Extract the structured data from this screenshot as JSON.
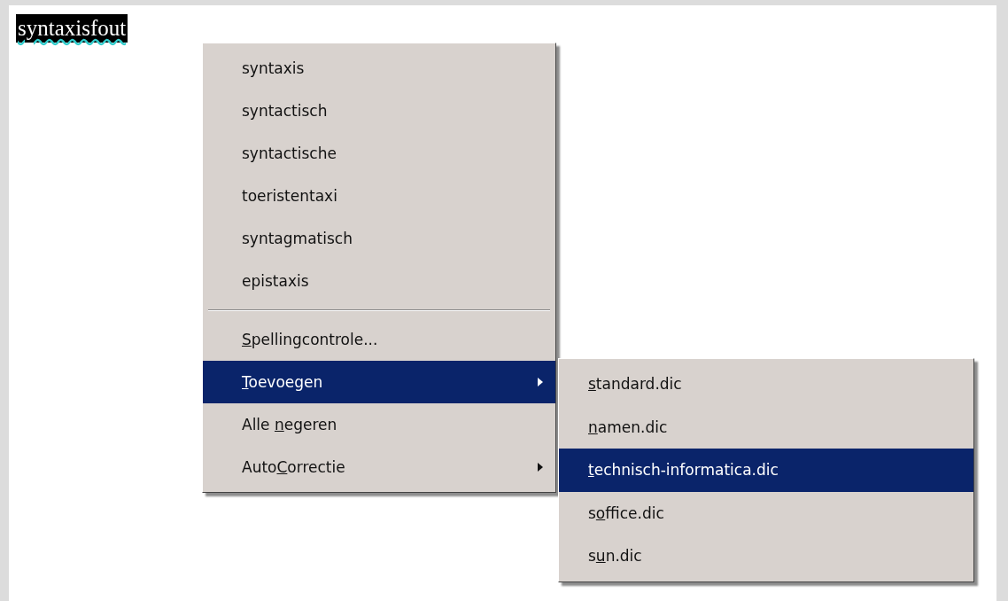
{
  "document": {
    "word": "syntaxisfout",
    "misspelled": true,
    "selected": true
  },
  "context_menu": {
    "suggestions": [
      {
        "label": "syntaxis"
      },
      {
        "label": "syntactisch"
      },
      {
        "label": "syntactische"
      },
      {
        "label": "toeristentaxi"
      },
      {
        "label": "syntagmatisch"
      },
      {
        "label": "epistaxis"
      }
    ],
    "commands": [
      {
        "key": "S",
        "after": "pellingcontrole...",
        "submenu": false,
        "selected": false
      },
      {
        "key": "T",
        "after": "oevoegen",
        "submenu": true,
        "selected": true
      },
      {
        "before": "Alle ",
        "key": "n",
        "after": "egeren",
        "submenu": false,
        "selected": false
      },
      {
        "before": "Auto",
        "key": "C",
        "after": "orrectie",
        "submenu": true,
        "selected": false
      }
    ]
  },
  "submenu": {
    "items": [
      {
        "key": "s",
        "after": "tandard.dic",
        "selected": false
      },
      {
        "key": "n",
        "after": "amen.dic",
        "selected": false
      },
      {
        "key": "t",
        "after": "echnisch-informatica.dic",
        "selected": true
      },
      {
        "before": "s",
        "key": "o",
        "after": "ffice.dic",
        "selected": false
      },
      {
        "before": "s",
        "key": "u",
        "after": "n.dic",
        "selected": false
      }
    ]
  }
}
